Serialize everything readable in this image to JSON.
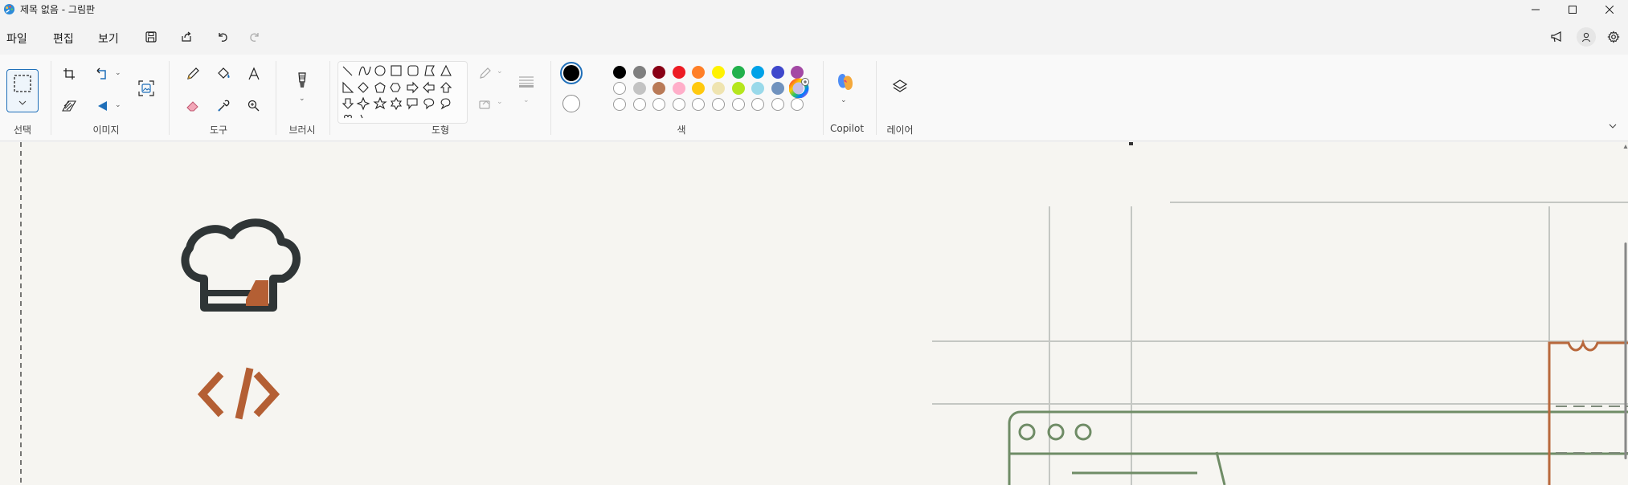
{
  "window": {
    "title": "제목 없음 - 그림판",
    "app_icon": "paint-palette-icon",
    "controls": [
      "minimize-icon",
      "maximize-icon",
      "close-icon"
    ]
  },
  "menu": {
    "items": [
      "파일",
      "편집",
      "보기"
    ],
    "quick_actions": [
      "save-icon",
      "share-icon",
      "undo-icon",
      "redo-icon"
    ],
    "right_actions": [
      "announcement-icon",
      "account-icon",
      "settings-icon"
    ]
  },
  "ribbon": {
    "groups": {
      "selection": "선택",
      "image": "이미지",
      "tools": "도구",
      "brushes": "브러시",
      "shapes": "도형",
      "colors": "색",
      "copilot": "Copilot",
      "layers": "레이어"
    },
    "image_tools": [
      "crop-icon",
      "rotate-icon",
      "resize-icon",
      "flip-icon",
      "image-generator-icon"
    ],
    "tools": [
      "pencil-icon",
      "fill-icon",
      "text-icon",
      "eraser-icon",
      "color-picker-icon",
      "magnifier-icon"
    ],
    "shapes": [
      "line",
      "curve",
      "oval",
      "rectangle",
      "rounded-rectangle",
      "polygon",
      "triangle",
      "right-triangle",
      "diamond",
      "pentagon",
      "hexagon",
      "right-arrow",
      "left-arrow",
      "up-arrow",
      "down-arrow",
      "four-point-star",
      "five-point-star",
      "six-point-star",
      "rounded-callout",
      "oval-callout",
      "cloud-callout",
      "heart",
      "lightning"
    ],
    "outline_fill": [
      "outline-icon",
      "fill-style-icon"
    ],
    "size_icon": "stroke-size-icon",
    "color_primary": "#000000",
    "color_secondary": "#ffffff",
    "palette_row1": [
      "#000000",
      "#7f7f7f",
      "#880015",
      "#ed1c24",
      "#ff7f27",
      "#fff200",
      "#22b14c",
      "#00a2e8",
      "#3f48cc",
      "#a349a4"
    ],
    "palette_row2": [
      "#ffffff",
      "#c3c3c3",
      "#b97a57",
      "#ffaec9",
      "#ffc90e",
      "#efe4b0",
      "#b5e61d",
      "#99d9ea",
      "#7092be",
      "#c8bfe7"
    ],
    "palette_row3_empty": 10,
    "edit_colors_icon": "color-wheel-icon",
    "copilot_icon": "copilot-icon",
    "layers_icon": "layers-icon",
    "collapse_icon": "chevron-down-icon"
  },
  "canvas": {
    "background": "#f6f5f1",
    "logo_dark": "#2f3536",
    "logo_accent": "#b45f34",
    "sketch_green": "#6f8c66",
    "sketch_orange": "#b8683c"
  }
}
